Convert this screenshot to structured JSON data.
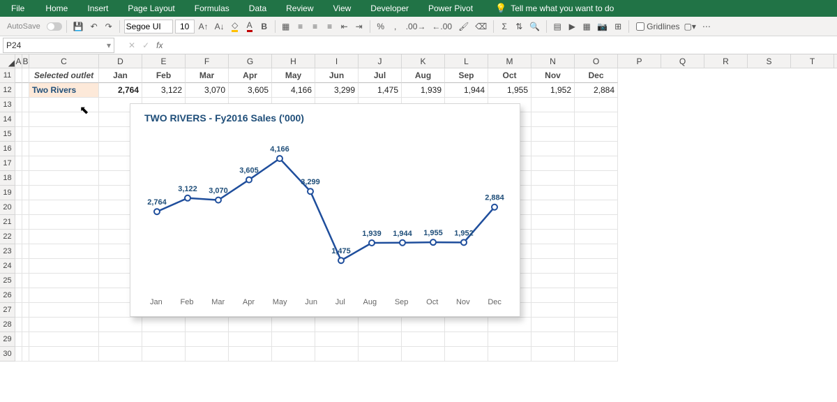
{
  "ribbon": {
    "tabs": [
      "File",
      "Home",
      "Insert",
      "Page Layout",
      "Formulas",
      "Data",
      "Review",
      "View",
      "Developer",
      "Power Pivot"
    ],
    "tell_me_placeholder": "Tell me what you want to do"
  },
  "toolbar": {
    "autosave": "AutoSave",
    "font_name": "Segoe UI",
    "font_size": "10",
    "gridlines_label": "Gridlines"
  },
  "namebox": {
    "value": "P24"
  },
  "columns": [
    "A",
    "B",
    "C",
    "D",
    "E",
    "F",
    "G",
    "H",
    "I",
    "J",
    "K",
    "L",
    "M",
    "N",
    "O",
    "P",
    "Q",
    "R",
    "S",
    "T"
  ],
  "rows_visible": [
    11,
    12,
    13,
    14,
    15,
    16,
    17,
    18,
    19,
    20,
    21,
    22,
    23,
    24,
    25,
    26,
    27,
    28,
    29,
    30
  ],
  "table": {
    "header_label": "Selected outlet",
    "months": [
      "Jan",
      "Feb",
      "Mar",
      "Apr",
      "May",
      "Jun",
      "Jul",
      "Aug",
      "Sep",
      "Oct",
      "Nov",
      "Dec"
    ],
    "outlet_name": "Two Rivers",
    "values": [
      "2,764",
      "3,122",
      "3,070",
      "3,605",
      "4,166",
      "3,299",
      "1,475",
      "1,939",
      "1,944",
      "1,955",
      "1,952",
      "2,884"
    ]
  },
  "chart_data": {
    "type": "line",
    "title": "TWO RIVERS - Fy2016 Sales ('000)",
    "categories": [
      "Jan",
      "Feb",
      "Mar",
      "Apr",
      "May",
      "Jun",
      "Jul",
      "Aug",
      "Sep",
      "Oct",
      "Nov",
      "Dec"
    ],
    "values": [
      2764,
      3122,
      3070,
      3605,
      4166,
      3299,
      1475,
      1939,
      1944,
      1955,
      1952,
      2884
    ],
    "data_labels": [
      "2,764",
      "3,122",
      "3,070",
      "3,605",
      "4,166",
      "3,299",
      "1,475",
      "1,939",
      "1,944",
      "1,955",
      "1,952",
      "2,884"
    ],
    "ylim": [
      1000,
      4500
    ],
    "xlabel": "",
    "ylabel": ""
  }
}
